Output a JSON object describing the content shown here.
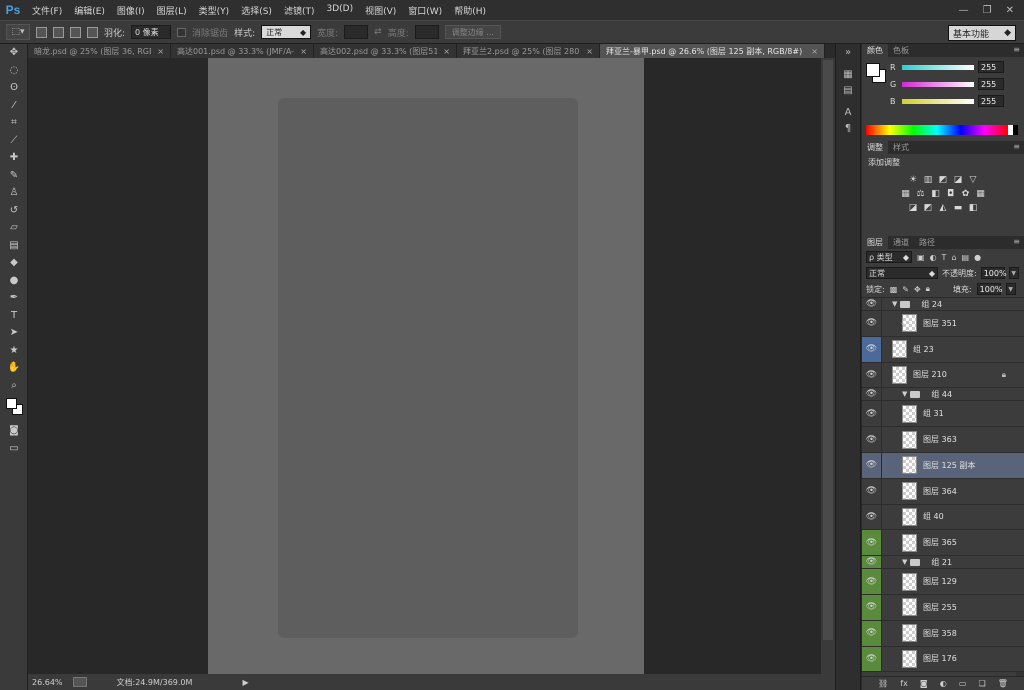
{
  "app": {
    "logo": "Ps"
  },
  "menu": [
    "文件(F)",
    "编辑(E)",
    "图像(I)",
    "图层(L)",
    "类型(Y)",
    "选择(S)",
    "滤镜(T)",
    "3D(D)",
    "视图(V)",
    "窗口(W)",
    "帮助(H)"
  ],
  "window_controls": {
    "minimize": "—",
    "restore": "❐",
    "close": "✕"
  },
  "options": {
    "feather_label": "羽化:",
    "feather_value": "0 像素",
    "antialias_label": "消除锯齿",
    "style_label": "样式:",
    "style_value": "正常",
    "width_label": "宽度:",
    "height_label": "高度:",
    "refine_edge": "调整边缘 ...",
    "workspace": "基本功能"
  },
  "tabs": [
    {
      "label": "暗龙.psd @ 25% (图层 36, RGB/...",
      "active": false
    },
    {
      "label": "高达001.psd @ 33.3% (JMF/A-8...",
      "active": false
    },
    {
      "label": "高达002.psd @ 33.3% (图层51, ...",
      "active": false
    },
    {
      "label": "拜亚兰2.psd @ 25% (图层 280, ...",
      "active": false
    },
    {
      "label": "拜亚兰-暴甲.psd @ 26.6% (图层 125 副本, RGB/8#)",
      "active": true
    }
  ],
  "tab_close": "×",
  "status": {
    "zoom": "26.64%",
    "doc_info": "文档:24.9M/369.0M",
    "arrow": "▶"
  },
  "panels": {
    "color": {
      "tabs": [
        "颜色",
        "色板"
      ],
      "channels": [
        {
          "label": "R",
          "value": "255",
          "color": "#2ad1d1"
        },
        {
          "label": "G",
          "value": "255",
          "color": "#d12ad1"
        },
        {
          "label": "B",
          "value": "255",
          "color": "#d1d12a"
        }
      ]
    },
    "adjustments": {
      "tabs": [
        "调整",
        "样式"
      ],
      "title": "添加调整"
    },
    "layers": {
      "tabs": [
        "图层",
        "通道",
        "路径"
      ],
      "kind": "ρ 类型",
      "blend_mode": "正常",
      "opacity_label": "不透明度:",
      "opacity_value": "100%",
      "lock_label": "锁定:",
      "fill_label": "填充:",
      "fill_value": "100%",
      "items": [
        {
          "name": "组 24",
          "type": "group",
          "indent": 0,
          "eye": "plain"
        },
        {
          "name": "图层 351",
          "type": "layer",
          "indent": 1,
          "eye": "plain",
          "clip": true
        },
        {
          "name": "组 23",
          "type": "layer",
          "indent": 0,
          "eye": "blue"
        },
        {
          "name": "图层 210",
          "type": "layer",
          "indent": 0,
          "eye": "plain",
          "locked": true
        },
        {
          "name": "组 44",
          "type": "group",
          "indent": 1,
          "eye": "plain"
        },
        {
          "name": "组 31",
          "type": "layer",
          "indent": 1,
          "eye": "plain"
        },
        {
          "name": "图层 363",
          "type": "layer",
          "indent": 1,
          "eye": "plain"
        },
        {
          "name": "图层 125 副本",
          "type": "layer",
          "indent": 1,
          "eye": "plain",
          "selected": true
        },
        {
          "name": "图层 364",
          "type": "layer",
          "indent": 1,
          "eye": "plain"
        },
        {
          "name": "组 40",
          "type": "layer",
          "indent": 1,
          "eye": "plain"
        },
        {
          "name": "图层 365",
          "type": "layer",
          "indent": 1,
          "eye": "green"
        },
        {
          "name": "组 21",
          "type": "group",
          "indent": 1,
          "eye": "green"
        },
        {
          "name": "图层 129",
          "type": "layer",
          "indent": 1,
          "eye": "green"
        },
        {
          "name": "图层 255",
          "type": "layer",
          "indent": 1,
          "eye": "green"
        },
        {
          "name": "图层 358",
          "type": "layer",
          "indent": 1,
          "eye": "green"
        },
        {
          "name": "图层 176",
          "type": "layer",
          "indent": 1,
          "eye": "green"
        }
      ]
    }
  }
}
